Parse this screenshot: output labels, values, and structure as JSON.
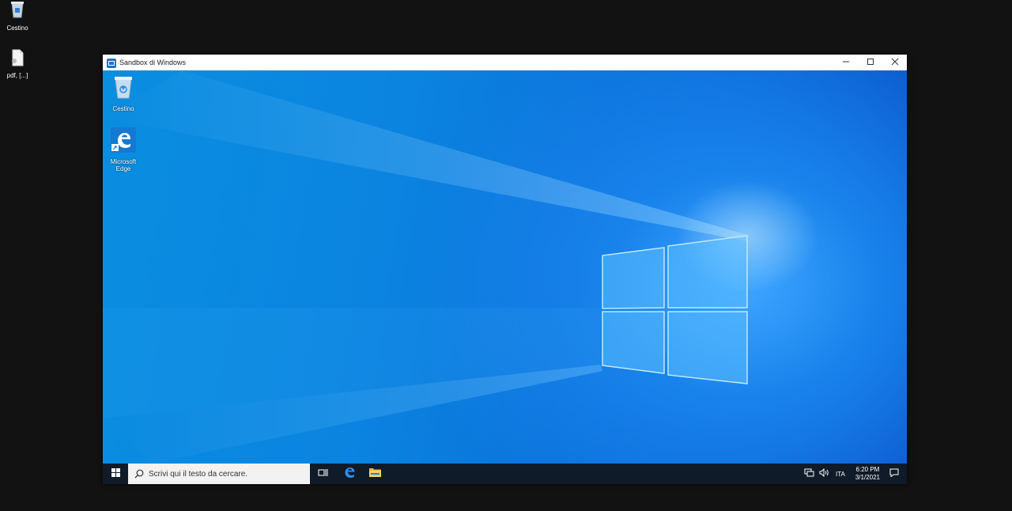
{
  "host": {
    "icons": [
      {
        "label": "Cestino",
        "icon": "recycle-bin-icon"
      },
      {
        "label": "pdf, [...]",
        "icon": "file-icon"
      }
    ]
  },
  "window": {
    "title": "Sandbox di Windows",
    "controls": [
      "minimize-icon",
      "maximize-icon",
      "close-icon"
    ]
  },
  "sandbox": {
    "desktop_icons": [
      {
        "label": "Cestino",
        "icon": "recycle-bin-icon"
      },
      {
        "label": "Microsoft Edge",
        "icon": "edge-icon"
      }
    ],
    "taskbar": {
      "search_placeholder": "Scrivi qui il testo da cercare.",
      "pinned": [
        "task-view-icon",
        "edge-icon",
        "file-explorer-icon"
      ],
      "language": "ITA",
      "time": "6:20 PM",
      "date": "3/1/2021"
    }
  },
  "colors": {
    "wallpaper": "#0a7fe0",
    "taskbar": "#0f1b28",
    "host_bg": "#121212"
  }
}
